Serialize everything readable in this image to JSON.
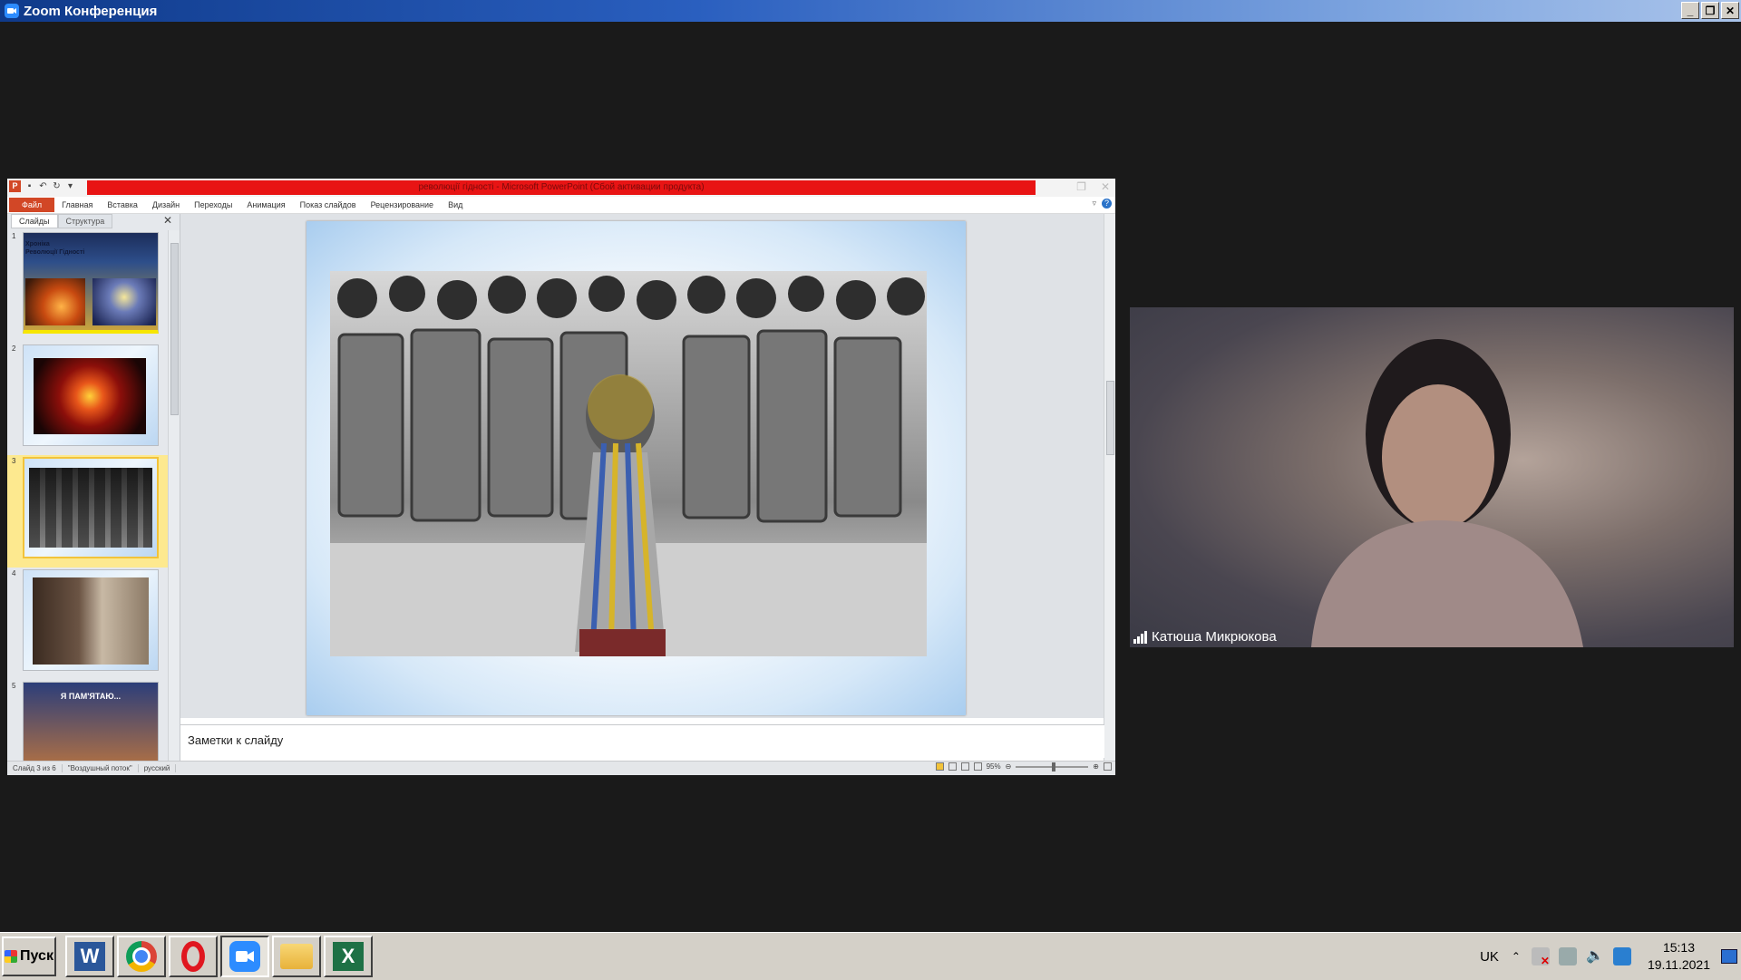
{
  "zoom_window": {
    "title": "Zoom Конференция",
    "buttons": {
      "minimize": "_",
      "restore": "❐",
      "close": "✕"
    }
  },
  "powerpoint": {
    "title": "революції гідності  -  Microsoft PowerPoint (Сбой активации продукта)",
    "ribbon_tabs": [
      "Файл",
      "Главная",
      "Вставка",
      "Дизайн",
      "Переходы",
      "Анимация",
      "Показ слайдов",
      "Рецензирование",
      "Вид"
    ],
    "pane_tabs": [
      "Слайды",
      "Структура"
    ],
    "pane_close": "✕",
    "slides": [
      {
        "number": "1",
        "text_line1": "Хроніка",
        "text_line2": "Революції Гідності"
      },
      {
        "number": "2"
      },
      {
        "number": "3"
      },
      {
        "number": "4"
      },
      {
        "number": "5",
        "text_line1": "Я ПАМ'ЯТАЮ..."
      }
    ],
    "notes_placeholder": "Заметки к слайду",
    "status": {
      "slide_counter": "Слайд 3 из 6",
      "theme": "\"Воздушный поток\"",
      "language": "русский",
      "zoom": "95%"
    }
  },
  "video": {
    "participant_name": "Катюша Микрюкова"
  },
  "taskbar": {
    "start_label": "Пуск",
    "language": "UK",
    "time": "15:13",
    "date": "19.11.2021"
  },
  "colors": {
    "ppt_accent": "#d24726",
    "activation_bar": "#e81414",
    "zoom_blue": "#2d8cff"
  }
}
